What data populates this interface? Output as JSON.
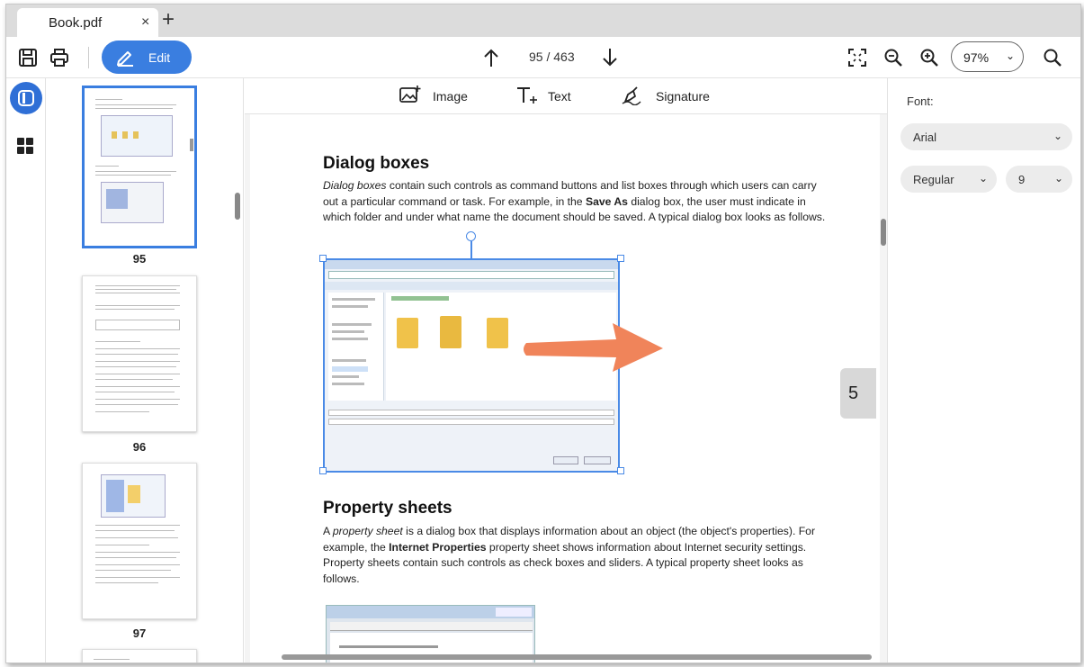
{
  "tab": {
    "title": "Book.pdf",
    "close": "×",
    "new": "+"
  },
  "toolbar": {
    "edit_label": "Edit",
    "page_indicator": "95 / 463",
    "zoom_value": "97%",
    "zoom_chevron": "⌄"
  },
  "thumbnails": [
    {
      "number": "95",
      "selected": true
    },
    {
      "number": "96",
      "selected": false
    },
    {
      "number": "97",
      "selected": false
    }
  ],
  "insert_bar": {
    "image": "Image",
    "text": "Text",
    "signature": "Signature"
  },
  "document": {
    "heading1": "Dialog boxes",
    "para1_em": "Dialog boxes",
    "para1_a": " contain such controls as command buttons and list boxes through which users can carry out a particular command or task. For example, in the ",
    "para1_b": "Save As",
    "para1_c": " dialog box, the user must indicate in which folder and under what name the document should be saved. A typical dialog box looks as follows.",
    "heading2": "Property sheets",
    "para2_a": "A ",
    "para2_em": "property sheet",
    "para2_b": " is a dialog box that displays information about an object (the object's properties). For example, the ",
    "para2_c": "Internet Properties",
    "para2_d": " property sheet shows information about Internet security settings. Property sheets contain such controls as check boxes and sliders. A typical property sheet looks as follows.",
    "page_badge": "5"
  },
  "right_panel": {
    "font_label": "Font:",
    "font_family": "Arial",
    "font_style": "Regular",
    "font_size": "9"
  },
  "colors": {
    "accent": "#3a7ee0",
    "arrow": "#f0845a"
  }
}
